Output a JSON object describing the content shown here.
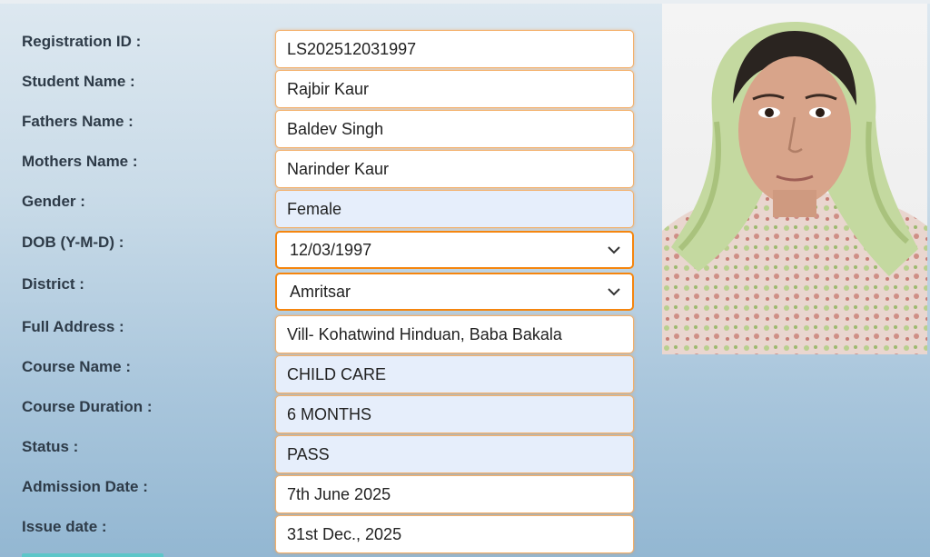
{
  "form": {
    "rows": [
      {
        "label": "Registration ID :",
        "value": "LS202512031997",
        "style": "white"
      },
      {
        "label": "Student Name :",
        "value": "Rajbir Kaur",
        "style": "white"
      },
      {
        "label": "Fathers Name :",
        "value": "Baldev Singh",
        "style": "white"
      },
      {
        "label": "Mothers Name :",
        "value": "Narinder Kaur",
        "style": "white"
      },
      {
        "label": "Gender :",
        "value": "Female",
        "style": "blue"
      },
      {
        "label": "DOB (Y-M-D) :",
        "value": "12/03/1997",
        "style": "select"
      },
      {
        "label": "District :",
        "value": "Amritsar",
        "style": "select"
      },
      {
        "label": "Full Address :",
        "value": "Vill- Kohatwind Hinduan, Baba Bakala",
        "style": "white"
      },
      {
        "label": "Course Name :",
        "value": "CHILD CARE",
        "style": "blue"
      },
      {
        "label": "Course Duration :",
        "value": "6 MONTHS",
        "style": "blue"
      },
      {
        "label": "Status :",
        "value": "PASS",
        "style": "blue"
      },
      {
        "label": "Admission Date :",
        "value": "7th June 2025",
        "style": "white"
      },
      {
        "label": "Issue date :",
        "value": "31st Dec., 2025",
        "style": "white"
      }
    ]
  },
  "colors": {
    "field_border": "#f4b06a",
    "select_border": "#f5860f",
    "readonly_bg": "#e6eefb",
    "label_text": "#2e3b48"
  },
  "photo": {
    "icon": "student-photo"
  }
}
